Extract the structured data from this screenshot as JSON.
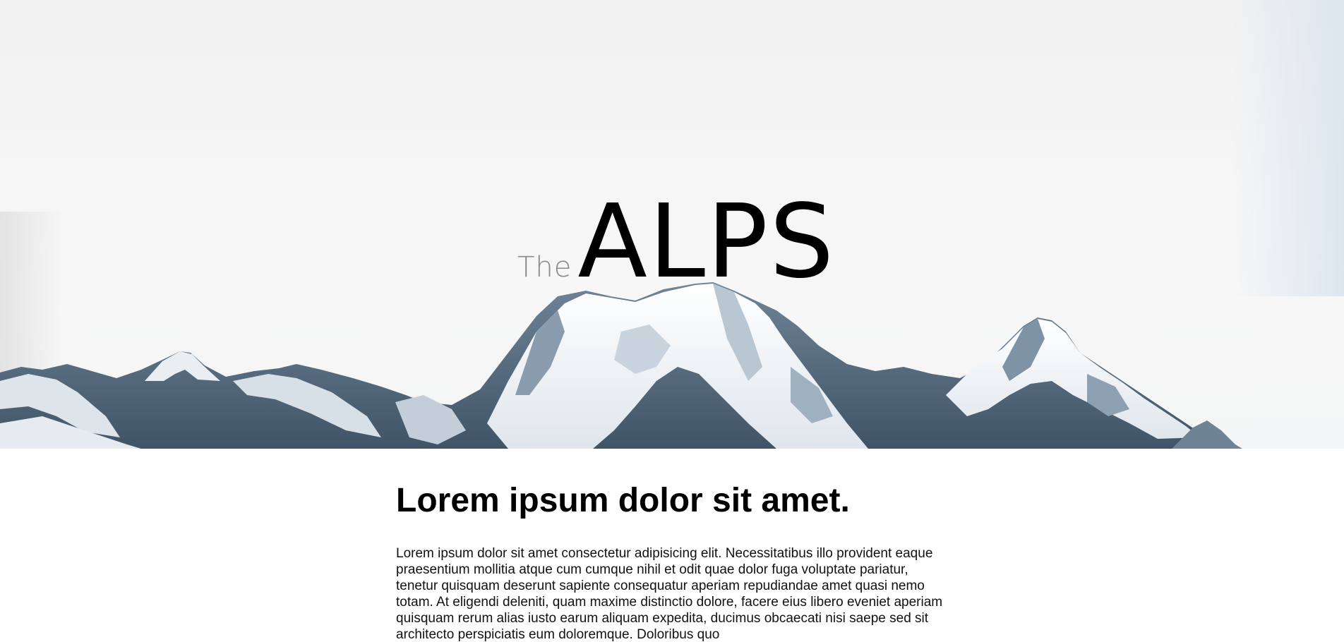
{
  "hero": {
    "title_prefix": "The",
    "title_main": "ALPS"
  },
  "article": {
    "heading": "Lorem ipsum dolor sit amet.",
    "body": "Lorem ipsum dolor sit amet consectetur adipisicing elit. Necessitatibus illo provident eaque praesentium mollitia atque cum cumque nihil et odit quae dolor fuga voluptate pariatur, tenetur quisquam deserunt sapiente consequatur aperiam repudiandae amet quasi nemo totam. At eligendi deleniti, quam maxime distinctio dolore, facere eius libero eveniet aperiam quisquam rerum alias iusto earum aliquam expedita, ducimus obcaecati nisi saepe sed sit architecto perspiciatis eum doloremque. Doloribus quo"
  },
  "colors": {
    "sky": "#f6f6f6",
    "rock": "#4f6579",
    "snow": "#ffffff",
    "text": "#000000"
  }
}
